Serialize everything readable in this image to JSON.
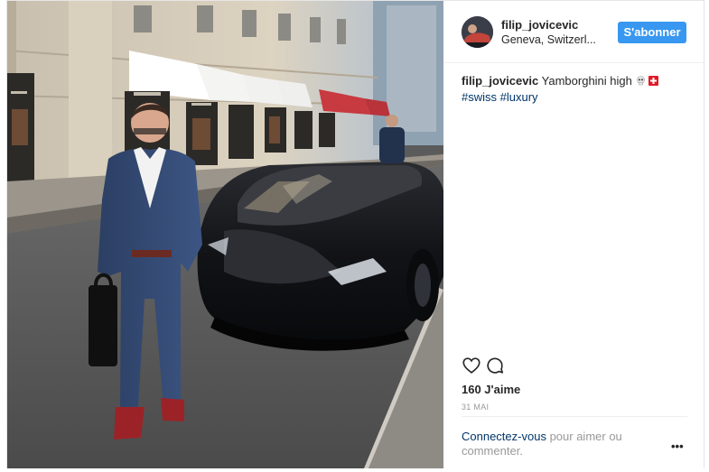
{
  "post": {
    "image_alt": "Man in a blue suit standing beside a black Lamborghini on a city street",
    "header": {
      "username": "filip_jovicevic",
      "location": "Geneva, Switzerl...",
      "follow_label": "S'abonner"
    },
    "caption": {
      "username": "filip_jovicevic",
      "text": "Yamborghini high",
      "hashtags": [
        "#swiss",
        "#luxury"
      ]
    },
    "likes": "160 J'aime",
    "date": "31 MAI",
    "login_prompt": {
      "link": "Connectez-vous",
      "text": " pour aimer ou commenter."
    },
    "more_label": "•••"
  },
  "icons": [
    "heart-icon",
    "comment-icon",
    "skull-emoji-icon",
    "swiss-flag-icon",
    "more-icon"
  ],
  "colors": {
    "accent": "#3897f0",
    "link": "#003569",
    "muted": "#999999",
    "text": "#262626"
  }
}
